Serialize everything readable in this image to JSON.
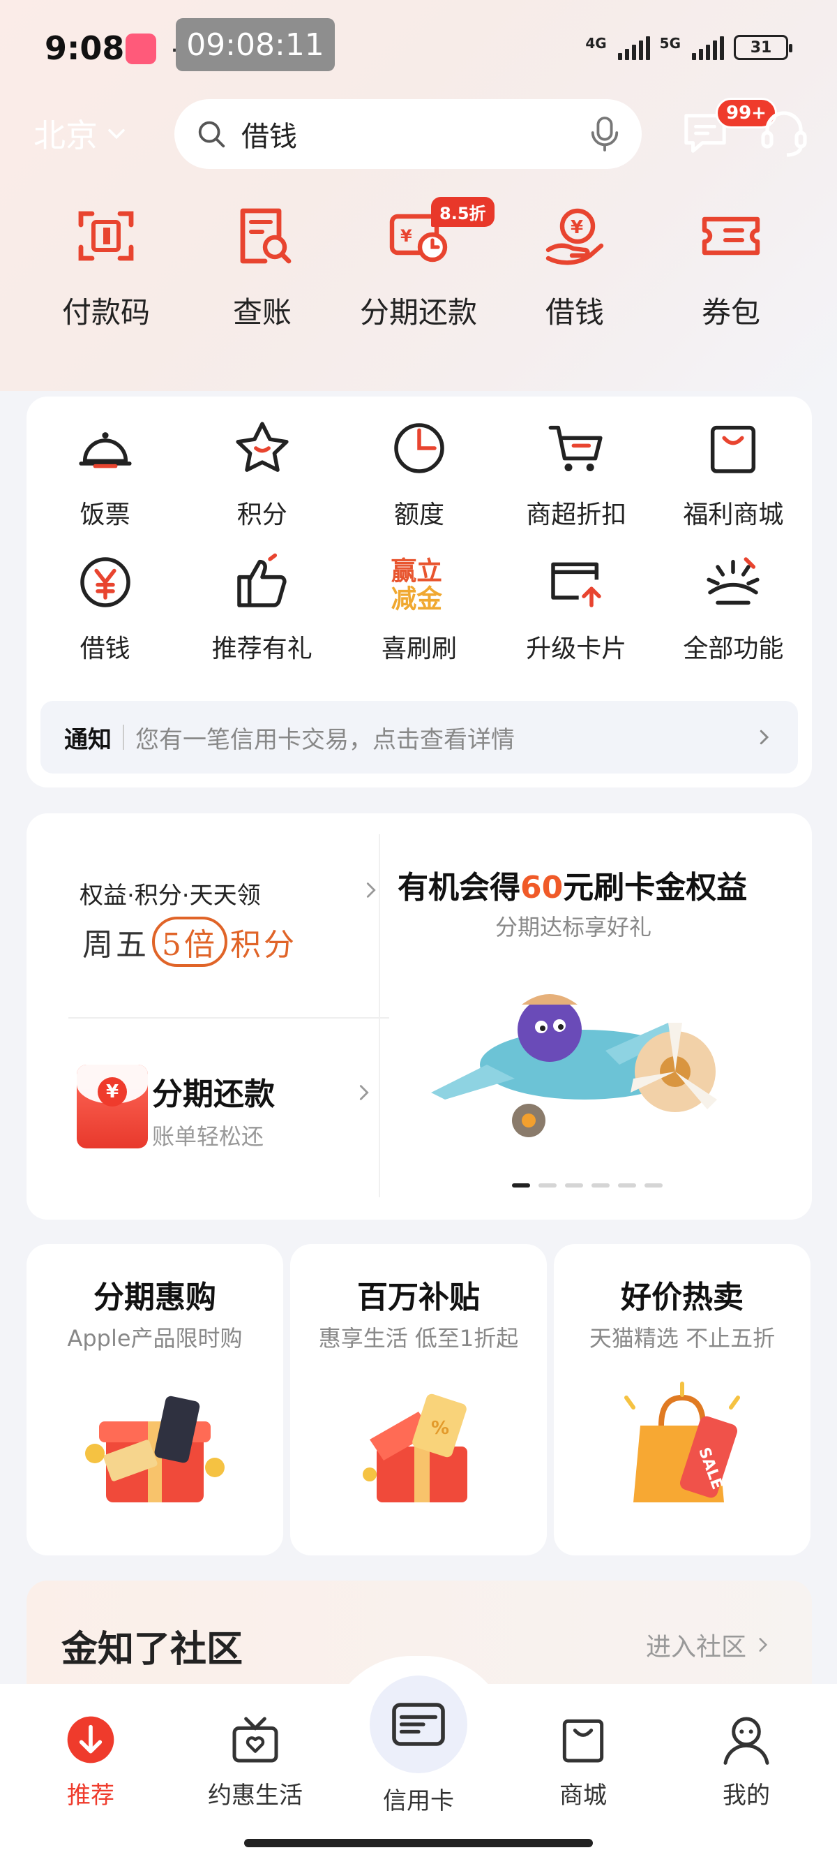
{
  "status_bar": {
    "time": "9:08",
    "recording_clock": "09:08:11",
    "dots": "…",
    "net1": "4G",
    "net2": "5G",
    "battery": "31"
  },
  "header": {
    "city": "北京",
    "search_value": "借钱",
    "message_badge": "99+"
  },
  "quick_actions": [
    {
      "label": "付款码",
      "icon": "scan-code-icon"
    },
    {
      "label": "查账",
      "icon": "bill-search-icon"
    },
    {
      "label": "分期还款",
      "icon": "installment-icon",
      "badge": "8.5折"
    },
    {
      "label": "借钱",
      "icon": "loan-hand-icon"
    },
    {
      "label": "券包",
      "icon": "coupon-icon"
    }
  ],
  "grid": {
    "items": [
      {
        "label": "饭票",
        "icon": "dome-dish-icon"
      },
      {
        "label": "积分",
        "icon": "star-icon"
      },
      {
        "label": "额度",
        "icon": "clock-pie-icon"
      },
      {
        "label": "商超折扣",
        "icon": "cart-icon"
      },
      {
        "label": "福利商城",
        "icon": "shopping-bag-icon"
      },
      {
        "label": "借钱",
        "icon": "yuan-circle-icon"
      },
      {
        "label": "推荐有礼",
        "icon": "thumbs-up-icon"
      },
      {
        "label": "喜刷刷",
        "icon": "win-gold-icon"
      },
      {
        "label": "升级卡片",
        "icon": "card-upgrade-icon"
      },
      {
        "label": "全部功能",
        "icon": "sunrise-icon"
      }
    ],
    "notice_tag": "通知",
    "notice_text": "您有一笔信用卡交易，点击查看详情"
  },
  "promo": {
    "left_top_title": "权益·积分·天天领",
    "left_top_a": "周五",
    "left_top_b": "5倍",
    "left_top_c": "积分",
    "left_bottom_title": "分期还款",
    "left_bottom_sub": "账单轻松还",
    "right_title_a": "有机会得",
    "right_title_hl": "60",
    "right_title_b": "元刷卡金权益",
    "right_sub": "分期达标享好礼",
    "page_count": 6,
    "page_active": 1
  },
  "features": [
    {
      "title": "分期惠购",
      "sub": "Apple产品限时购"
    },
    {
      "title": "百万补贴",
      "sub": "惠享生活 低至1折起"
    },
    {
      "title": "好价热卖",
      "sub": "天猫精选 不止五折"
    }
  ],
  "community": {
    "title": "金知了社区",
    "link": "进入社区"
  },
  "tabs": {
    "recommend": "推荐",
    "life": "约惠生活",
    "credit_card": "信用卡",
    "mall": "商城",
    "mine": "我的"
  },
  "colors": {
    "accent": "#ef3b2c",
    "highlight": "#f05a28"
  }
}
